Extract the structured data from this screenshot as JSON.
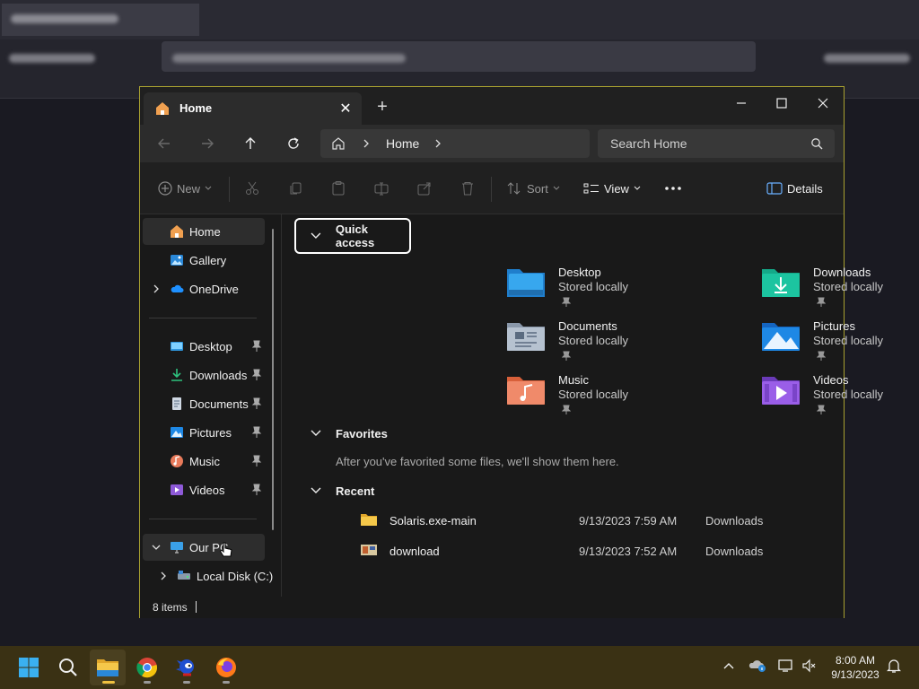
{
  "window": {
    "tab_title": "Home",
    "address_crumb": "Home",
    "search_placeholder": "Search Home"
  },
  "toolbar": {
    "new_label": "New",
    "sort_label": "Sort",
    "view_label": "View",
    "details_label": "Details"
  },
  "sidebar": {
    "top": [
      {
        "label": "Home",
        "icon": "home-icon"
      },
      {
        "label": "Gallery",
        "icon": "gallery-icon"
      },
      {
        "label": "OneDrive",
        "icon": "onedrive-icon"
      }
    ],
    "pinned": [
      {
        "label": "Desktop",
        "icon": "desktop-folder-icon"
      },
      {
        "label": "Downloads",
        "icon": "downloads-folder-icon"
      },
      {
        "label": "Documents",
        "icon": "documents-folder-icon"
      },
      {
        "label": "Pictures",
        "icon": "pictures-folder-icon"
      },
      {
        "label": "Music",
        "icon": "music-folder-icon"
      },
      {
        "label": "Videos",
        "icon": "videos-folder-icon"
      }
    ],
    "pc": [
      {
        "label": "Our PC",
        "icon": "pc-icon"
      },
      {
        "label": "Local Disk (C:)",
        "icon": "disk-icon"
      }
    ]
  },
  "quickAccess": {
    "title": "Quick access",
    "items": [
      {
        "name": "Desktop",
        "status": "Stored locally"
      },
      {
        "name": "Downloads",
        "status": "Stored locally"
      },
      {
        "name": "Documents",
        "status": "Stored locally"
      },
      {
        "name": "Pictures",
        "status": "Stored locally"
      },
      {
        "name": "Music",
        "status": "Stored locally"
      },
      {
        "name": "Videos",
        "status": "Stored locally"
      }
    ]
  },
  "favorites": {
    "title": "Favorites",
    "empty_text": "After you've favorited some files, we'll show them here."
  },
  "recent": {
    "title": "Recent",
    "items": [
      {
        "name": "Solaris.exe-main",
        "date": "9/13/2023 7:59 AM",
        "location": "Downloads"
      },
      {
        "name": "download",
        "date": "9/13/2023 7:52 AM",
        "location": "Downloads"
      }
    ]
  },
  "status": {
    "item_count": "8 items"
  },
  "taskbar": {
    "time": "8:00 AM",
    "date": "9/13/2023"
  },
  "colors": {
    "accent": "#a8a030",
    "taskbar": "#3a3114"
  }
}
